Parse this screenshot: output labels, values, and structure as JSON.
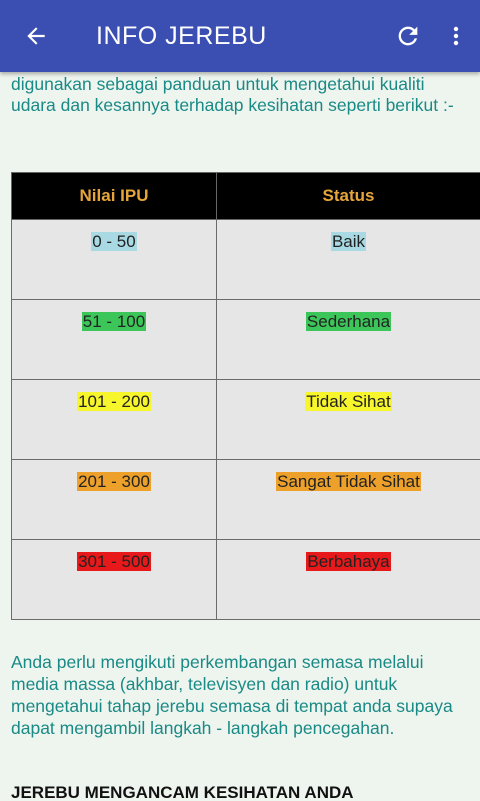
{
  "appbar": {
    "title": "INFO JEREBU",
    "color": "#3b4fb2",
    "back_icon": "arrow-left-icon",
    "refresh_icon": "refresh-icon",
    "menu_icon": "more-vertical-icon"
  },
  "intro_text": "digunakan sebagai panduan untuk mengetahui kualiti udara dan kesannya terhadap kesihatan seperti berikut :-",
  "table": {
    "headers": [
      "Nilai IPU",
      "Status"
    ],
    "rows": [
      {
        "range": "0 - 50",
        "status": "Baik",
        "color": "#a9d9e3"
      },
      {
        "range": "51 - 100",
        "status": "Sederhana",
        "color": "#3cc65a"
      },
      {
        "range": "101 - 200",
        "status": "Tidak Sihat",
        "color": "#f7f52c"
      },
      {
        "range": "201 - 300",
        "status": "Sangat Tidak Sihat",
        "color": "#eda12b"
      },
      {
        "range": "301 - 500",
        "status": "Berbahaya",
        "color": "#e8191a"
      }
    ]
  },
  "paragraph": "Anda perlu mengikuti perkembangan semasa melalui media massa (akhbar, televisyen dan radio) untuk mengetahui tahap jerebu semasa di tempat anda supaya dapat mengambil langkah - langkah pencegahan.",
  "section_heading": "JEREBU MENGANCAM KESIHATAN ANDA"
}
